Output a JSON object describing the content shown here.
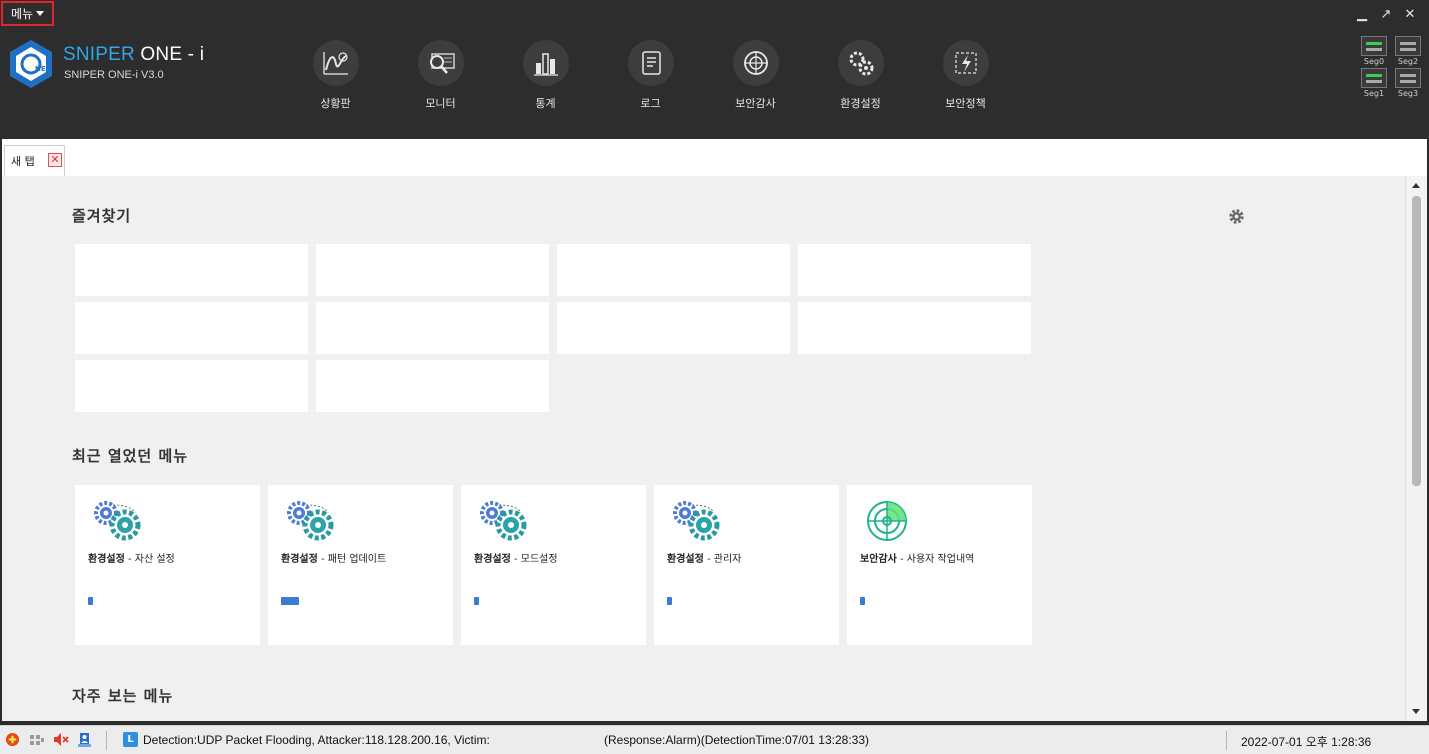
{
  "header": {
    "menu_label": "메뉴",
    "brand_title_accent": "SNIPER",
    "brand_title_rest": " ONE - i",
    "brand_subtitle": "SNIPER ONE-i V3.0",
    "nav": [
      {
        "label": "상황판",
        "icon": "dashboard-icon"
      },
      {
        "label": "모니터",
        "icon": "monitor-icon"
      },
      {
        "label": "통계",
        "icon": "statistics-icon"
      },
      {
        "label": "로그",
        "icon": "log-icon"
      },
      {
        "label": "보안감사",
        "icon": "security-audit-icon"
      },
      {
        "label": "환경설정",
        "icon": "settings-icon"
      },
      {
        "label": "보안정책",
        "icon": "security-policy-icon"
      }
    ],
    "segments": [
      {
        "label": "Seg0",
        "active": true
      },
      {
        "label": "Seg2",
        "active": false
      },
      {
        "label": "Seg1",
        "active": true
      },
      {
        "label": "Seg3",
        "active": false
      }
    ]
  },
  "tabs": [
    {
      "label": "새 탭"
    }
  ],
  "content": {
    "favorites_title": "즐겨찾기",
    "recent_title": "최근 열었던 메뉴",
    "frequent_title": "자주 보는 메뉴",
    "recent": [
      {
        "category": "환경설정",
        "name": " - 자산 설정",
        "icon": "gears-icon",
        "bar": 0.03
      },
      {
        "category": "환경설정",
        "name": " - 패턴 업데이트",
        "icon": "gears-icon",
        "bar": 0.1
      },
      {
        "category": "환경설정",
        "name": " - 모드설정",
        "icon": "gears-icon",
        "bar": 0.03
      },
      {
        "category": "환경설정",
        "name": " - 관리자",
        "icon": "gears-icon",
        "bar": 0.03
      },
      {
        "category": "보안감사",
        "name": " - 사용자 작업내역",
        "icon": "radar-icon",
        "bar": 0.03
      }
    ]
  },
  "status": {
    "message": "Detection:UDP Packet Flooding, Attacker:118.128.200.16, Victim:",
    "response": "(Response:Alarm)(DetectionTime:07/01 13:28:33)",
    "datetime": "2022-07-01 오후 1:28:36",
    "log_badge": "L"
  },
  "colors": {
    "accent": "#2ea6e8",
    "header_bg": "#2d2d2d",
    "menu_border": "#e0262e",
    "progress": "#3a7bd5"
  }
}
